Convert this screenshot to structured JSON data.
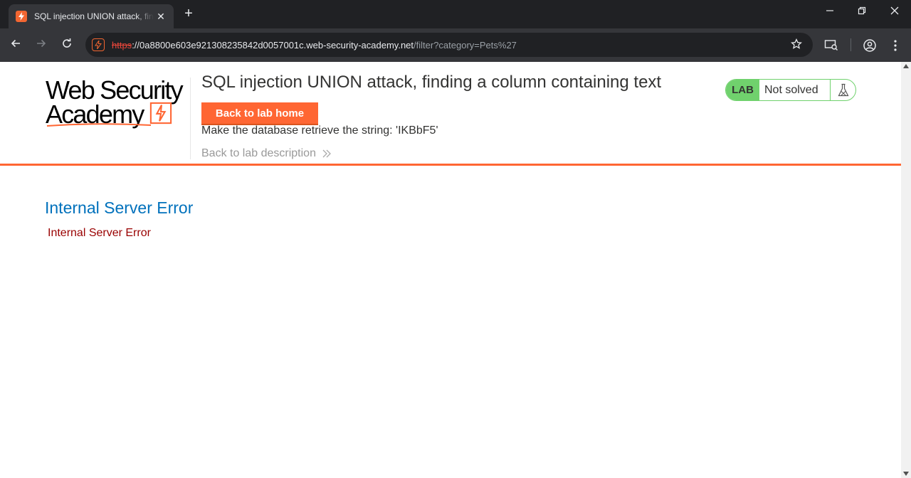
{
  "browser": {
    "tab_title": "SQL injection UNION attack, finding a column containing text",
    "tab_close": "✕",
    "new_tab": "+",
    "url_scheme": "https",
    "url_host": "://0a8800e603e921308235842d0057001c.web-security-academy.net",
    "url_path": "/filter?category=Pets%27",
    "icons": [
      "lightning-favicon",
      "back-arrow-icon",
      "forward-arrow-icon",
      "reload-icon",
      "site-info-icon",
      "star-icon",
      "cast-search-icon",
      "profile-icon",
      "menu-icon",
      "minimize-icon",
      "restore-icon",
      "close-icon"
    ]
  },
  "logo": {
    "line1": "Web Security",
    "line2": "Academy"
  },
  "header": {
    "title": "SQL injection UNION attack, finding a column containing text",
    "back_home": "Back to lab home",
    "description": "Make the database retrieve the string: 'IKBbF5'",
    "back_description": "Back to lab description"
  },
  "status": {
    "badge": "LAB",
    "text": "Not solved"
  },
  "error": {
    "title": "Internal Server Error",
    "message": "Internal Server Error"
  },
  "colors": {
    "accent_orange": "#ff6633",
    "status_green": "#70d16d",
    "error_blue": "#0071bc",
    "error_red": "#990000"
  }
}
